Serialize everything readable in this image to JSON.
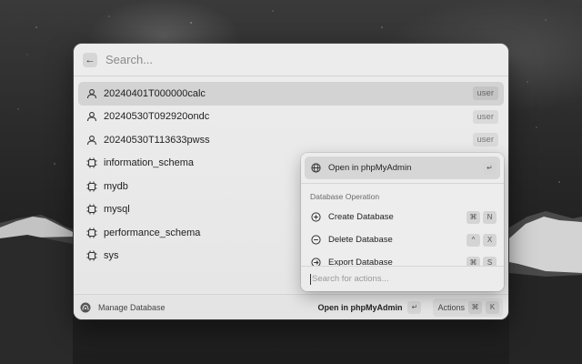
{
  "search": {
    "placeholder": "Search..."
  },
  "rows": [
    {
      "label": "20240401T000000calc",
      "tag": "user",
      "icon": "user-icon"
    },
    {
      "label": "20240530T092920ondc",
      "tag": "user",
      "icon": "user-icon"
    },
    {
      "label": "20240530T113633pwss",
      "tag": "user",
      "icon": "user-icon"
    },
    {
      "label": "information_schema",
      "icon": "database-chip-icon"
    },
    {
      "label": "mydb",
      "icon": "database-chip-icon"
    },
    {
      "label": "mysql",
      "icon": "database-chip-icon"
    },
    {
      "label": "performance_schema",
      "icon": "database-chip-icon"
    },
    {
      "label": "sys",
      "icon": "database-chip-icon"
    }
  ],
  "popover": {
    "primary": {
      "label": "Open in phpMyAdmin",
      "key": "↵"
    },
    "section_title": "Database Operation",
    "items": [
      {
        "label": "Create Database",
        "keys": [
          "⌘",
          "N"
        ]
      },
      {
        "label": "Delete Database",
        "keys": [
          "^",
          "X"
        ]
      },
      {
        "label": "Export Database",
        "keys": [
          "⌘",
          "S"
        ]
      }
    ],
    "search_placeholder": "Search for actions..."
  },
  "footer": {
    "title": "Manage Database",
    "primary_action": "Open in phpMyAdmin",
    "primary_key": "↵",
    "actions_label": "Actions",
    "actions_keys": [
      "⌘",
      "K"
    ]
  },
  "colors": {
    "window_bg": "#e9e9e9",
    "selected_bg": "#d3d3d3"
  }
}
